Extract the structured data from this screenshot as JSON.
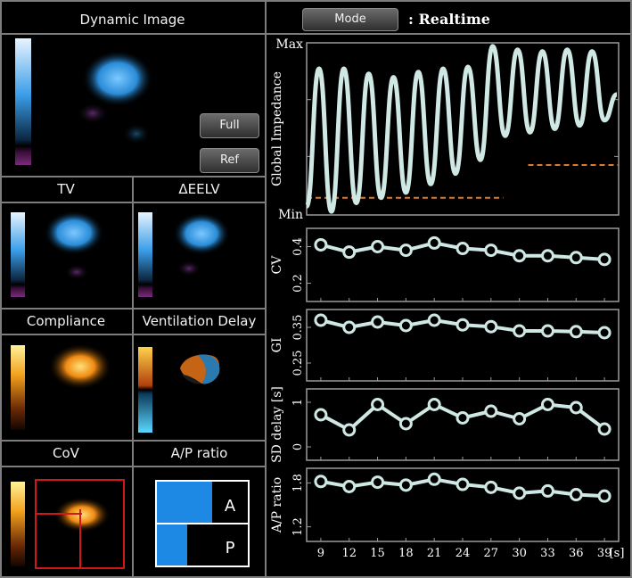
{
  "panels": {
    "dynamic_image": {
      "title": "Dynamic Image"
    },
    "tv": {
      "title": "TV"
    },
    "eelv": {
      "title": "ΔEELV"
    },
    "compliance": {
      "title": "Compliance"
    },
    "ventilation_delay": {
      "title": "Ventilation Delay"
    },
    "cov": {
      "title": "CoV"
    },
    "ap_ratio": {
      "title": "A/P ratio",
      "anterior_label": "A",
      "posterior_label": "P",
      "anterior_fraction": 0.61,
      "posterior_fraction": 0.33
    }
  },
  "buttons": {
    "mode_label": "Mode",
    "full_label": "Full",
    "ref_label": "Ref"
  },
  "header": {
    "mode_value": ": Realtime"
  },
  "colors": {
    "trace": "#cfe8e4",
    "reference_line": "#e07a2a",
    "bar": "#1e88e5",
    "cov_box": "#d01818",
    "border": "#7d7d7d"
  },
  "chart_data": [
    {
      "type": "line",
      "ylabel": "Global Impedance",
      "yticks": [
        "Max",
        "Min"
      ],
      "title": "",
      "series": [
        {
          "values": [
            0.05,
            0.85,
            0.02,
            0.85,
            0.07,
            0.82,
            0.1,
            0.8,
            0.13,
            0.83,
            0.18,
            0.85,
            0.24,
            0.86,
            0.32,
            0.98,
            0.46,
            0.96,
            0.48,
            0.95,
            0.5,
            0.96,
            0.52,
            0.95,
            0.55,
            0.7
          ]
        }
      ],
      "reference_levels": [
        {
          "x_start": 0.0,
          "x_end": 0.63,
          "level": 0.1
        },
        {
          "x_start": 0.71,
          "x_end": 1.0,
          "level": 0.29
        }
      ]
    },
    {
      "type": "line",
      "ylabel": "CV",
      "yticks": [
        "0.4",
        "0.2"
      ],
      "ylim": [
        0.1,
        0.5
      ],
      "x": [
        9,
        12,
        15,
        18,
        21,
        24,
        27,
        30,
        33,
        36,
        39
      ],
      "series": [
        {
          "values": [
            0.41,
            0.37,
            0.4,
            0.38,
            0.42,
            0.39,
            0.38,
            0.35,
            0.35,
            0.34,
            0.33
          ]
        }
      ]
    },
    {
      "type": "line",
      "ylabel": "GI",
      "yticks": [
        "0.35",
        "0.25"
      ],
      "ylim": [
        0.2,
        0.4
      ],
      "x": [
        9,
        12,
        15,
        18,
        21,
        24,
        27,
        30,
        33,
        36,
        39
      ],
      "series": [
        {
          "values": [
            0.37,
            0.35,
            0.365,
            0.355,
            0.37,
            0.357,
            0.352,
            0.34,
            0.34,
            0.338,
            0.335
          ]
        }
      ]
    },
    {
      "type": "line",
      "ylabel": "SD delay [s]",
      "yticks": [
        "1",
        "0"
      ],
      "ylim": [
        -0.3,
        1.3
      ],
      "x": [
        9,
        12,
        15,
        18,
        21,
        24,
        27,
        30,
        33,
        36,
        39
      ],
      "series": [
        {
          "values": [
            0.72,
            0.38,
            0.95,
            0.52,
            0.95,
            0.65,
            0.8,
            0.63,
            0.95,
            0.88,
            0.4
          ]
        }
      ]
    },
    {
      "type": "line",
      "ylabel": "A/P ratio",
      "yticks": [
        "1.8",
        "1.2"
      ],
      "ylim": [
        1.0,
        2.0
      ],
      "x": [
        9,
        12,
        15,
        18,
        21,
        24,
        27,
        30,
        33,
        36,
        39
      ],
      "xticks": [
        "9",
        "12",
        "15",
        "18",
        "21",
        "24",
        "27",
        "30",
        "33",
        "36",
        "39"
      ],
      "xunit": "[s]",
      "series": [
        {
          "values": [
            1.82,
            1.75,
            1.81,
            1.77,
            1.85,
            1.78,
            1.74,
            1.66,
            1.69,
            1.64,
            1.62
          ]
        }
      ]
    }
  ]
}
